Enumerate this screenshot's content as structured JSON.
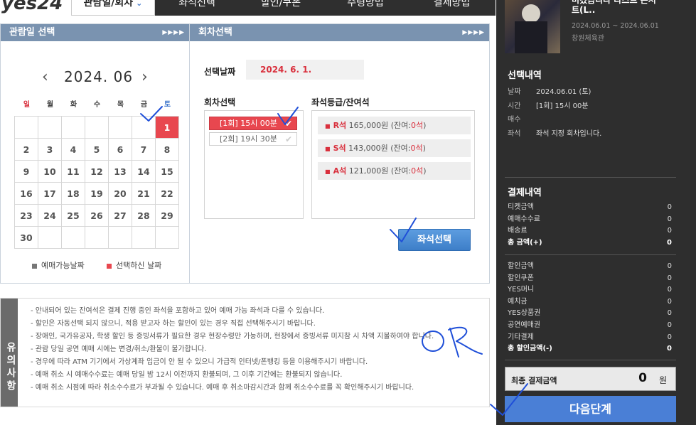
{
  "header": {
    "logo": "yes24",
    "tabs": [
      {
        "label": "관람일/회차"
      },
      {
        "label": "좌석선택"
      },
      {
        "label": "할인/쿠폰"
      },
      {
        "label": "수령방법"
      },
      {
        "label": "결제방법"
      }
    ]
  },
  "date_panel": {
    "title": "관람일 선택",
    "year_month": "2024. 06",
    "weekdays": [
      "일",
      "월",
      "화",
      "수",
      "목",
      "금",
      "토"
    ],
    "weekday_colors": [
      "#d9303d",
      "#444444",
      "#444444",
      "#444444",
      "#444444",
      "#444444",
      "#3a73c9"
    ],
    "weeks": [
      [
        "",
        "",
        "",
        "",
        "",
        "",
        "1"
      ],
      [
        "2",
        "3",
        "4",
        "5",
        "6",
        "7",
        "8"
      ],
      [
        "9",
        "10",
        "11",
        "12",
        "13",
        "14",
        "15"
      ],
      [
        "16",
        "17",
        "18",
        "19",
        "20",
        "21",
        "22"
      ],
      [
        "23",
        "24",
        "25",
        "26",
        "27",
        "28",
        "29"
      ],
      [
        "30",
        "",
        "",
        "",
        "",
        "",
        ""
      ]
    ],
    "selected_day": "1",
    "legend_available": "예매가능날짜",
    "legend_selected": "선택하신 날짜"
  },
  "round_panel": {
    "title": "회차선택",
    "date_label": "선택날짜",
    "date_value": "2024. 6. 1.",
    "round_label": "회차선택",
    "seat_label": "좌석등급/잔여석",
    "rounds": [
      {
        "label": "[1회] 15시 00분",
        "selected": true
      },
      {
        "label": "[2회] 19시 30분",
        "selected": false
      }
    ],
    "seats": [
      {
        "grade": "R석",
        "price": "165,000원",
        "remain_prefix": "(잔여:",
        "remain": "0석",
        "remain_suffix": ")"
      },
      {
        "grade": "S석",
        "price": "143,000원",
        "remain_prefix": "(잔여:",
        "remain": "0석",
        "remain_suffix": ")"
      },
      {
        "grade": "A석",
        "price": "121,000원",
        "remain_prefix": "(잔여:",
        "remain": "0석",
        "remain_suffix": ")"
      }
    ],
    "select_button": "좌석선택"
  },
  "notice": {
    "side_label": "유의사항",
    "items": [
      "- 안내되어 있는 잔여석은 결제 진행 중인 좌석을 포함하고 있어 예매 가능 좌석과 다를 수 있습니다.",
      "- 할인은 자동선택 되지 않으니, 적용 받고자 하는 할인이 있는 경우 직접 선택해주시기 바랍니다.",
      "- 장애인, 국가유공자, 학생 할인 등 증빙서류가 필요한 경우 현장수령만 가능하며, 현장에서 증빙서류 미지참 시 차액 지불하여야 합니다.",
      "- 관람 당일 공연 예매 시에는 변경/취소/환불이 불가합니다.",
      "- 경우에 따라 ATM 기기에서 가상계좌 입금이 안 될 수 있으니 가급적 인터넷/폰뱅킹 등을 이용해주시기 바랍니다.",
      "- 예매 취소 시 예매수수료는 예매 당일 밤 12시 이전까지 환불되며, 그 이후 기간에는 환불되지 않습니다.",
      "- 예매 취소 시점에 따라 취소수수료가 부과될 수 있습니다. 예매 후 취소마감시간과 함께 취소수수료를 꼭 확인해주시기 바랍니다."
    ]
  },
  "sidebar": {
    "show_title": "트(L..",
    "show_title_top": "미켰습니다 라스트 콘서",
    "show_period": "2024.06.01 ~ 2024.06.01",
    "show_venue": "창원체육관",
    "selection_title": "선택내역",
    "selection": [
      {
        "key": "날짜",
        "value": "2024.06.01 (토)"
      },
      {
        "key": "시간",
        "value": "[1회] 15시 00분"
      },
      {
        "key": "매수",
        "value": ""
      },
      {
        "key": "좌석",
        "value": "좌석 지정 회차입니다."
      }
    ],
    "payment_title": "결제내역",
    "payment": [
      {
        "key": "티켓금액",
        "value": "0"
      },
      {
        "key": "예매수수료",
        "value": "0"
      },
      {
        "key": "배송료",
        "value": "0"
      },
      {
        "key": "총 금액(+)",
        "value": "0",
        "bold": true
      }
    ],
    "discount": [
      {
        "key": "할인금액",
        "value": "0"
      },
      {
        "key": "할인쿠폰",
        "value": "0"
      },
      {
        "key": "YES머니",
        "value": "0"
      },
      {
        "key": "예치금",
        "value": "0"
      },
      {
        "key": "YES상품권",
        "value": "0"
      },
      {
        "key": "공연예매권",
        "value": "0"
      },
      {
        "key": "기타결제",
        "value": "0"
      },
      {
        "key": "총 할인금액(-)",
        "value": "0",
        "bold": true
      }
    ],
    "final_label": "최종 결제금액",
    "final_amount": "0",
    "final_unit": "원",
    "next_button": "다음단계"
  },
  "colors": {
    "accent_red": "#e8474f",
    "header_blue": "#7a93b0",
    "button_blue": "#4a7fd6",
    "sidebar_bg": "#2e2e2e",
    "annotation_ink": "#1f4fd8"
  }
}
